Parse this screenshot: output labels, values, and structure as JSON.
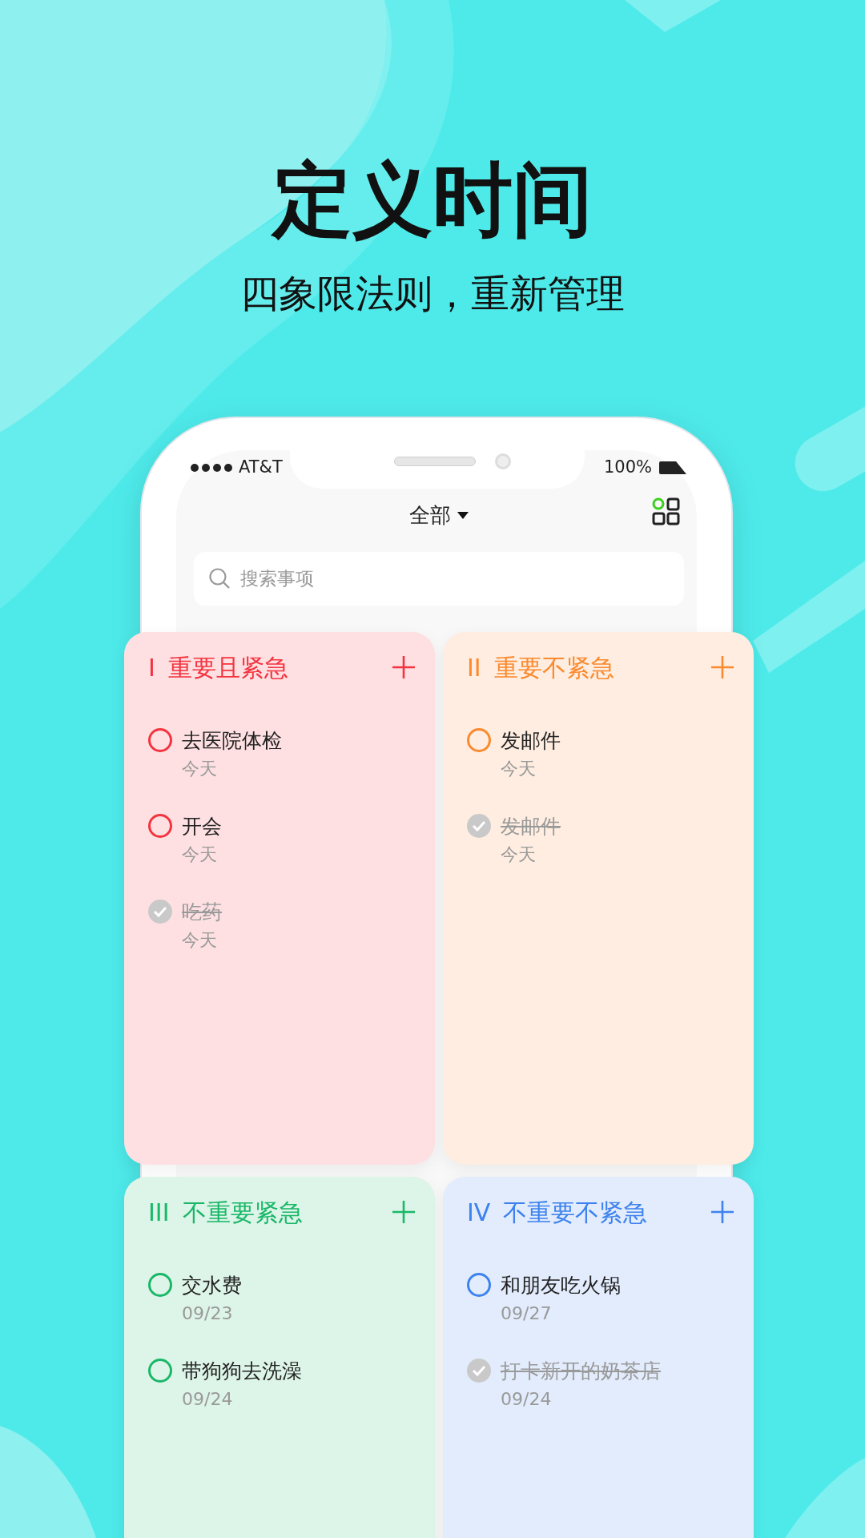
{
  "headline": "定义时间",
  "subtitle": "四象限法则，重新管理",
  "status_bar": {
    "carrier": "AT&T",
    "battery": "100%"
  },
  "header": {
    "filter": "全部"
  },
  "search": {
    "placeholder": "搜索事项"
  },
  "quadrants": [
    {
      "numeral": "I",
      "title": "重要且紧急",
      "color": "#f5333f",
      "tasks": [
        {
          "text": "去医院体检",
          "date": "今天",
          "checked": false
        },
        {
          "text": "开会",
          "date": "今天",
          "checked": false
        },
        {
          "text": "吃药",
          "date": "今天",
          "checked": true
        }
      ]
    },
    {
      "numeral": "II",
      "title": "重要不紧急",
      "color": "#fb8a2e",
      "tasks": [
        {
          "text": "发邮件",
          "date": "今天",
          "checked": false
        },
        {
          "text": "发邮件",
          "date": "今天",
          "checked": true
        }
      ]
    },
    {
      "numeral": "III",
      "title": "不重要紧急",
      "color": "#19b868",
      "tasks": [
        {
          "text": "交水费",
          "date": "09/23",
          "checked": false
        },
        {
          "text": "带狗狗去洗澡",
          "date": "09/24",
          "checked": false
        }
      ]
    },
    {
      "numeral": "IV",
      "title": "不重要不紧急",
      "color": "#3d82ee",
      "tasks": [
        {
          "text": "和朋友吃火锅",
          "date": "09/27",
          "checked": false
        },
        {
          "text": "打卡新开的奶茶店",
          "date": "09/24",
          "checked": true
        }
      ]
    }
  ]
}
